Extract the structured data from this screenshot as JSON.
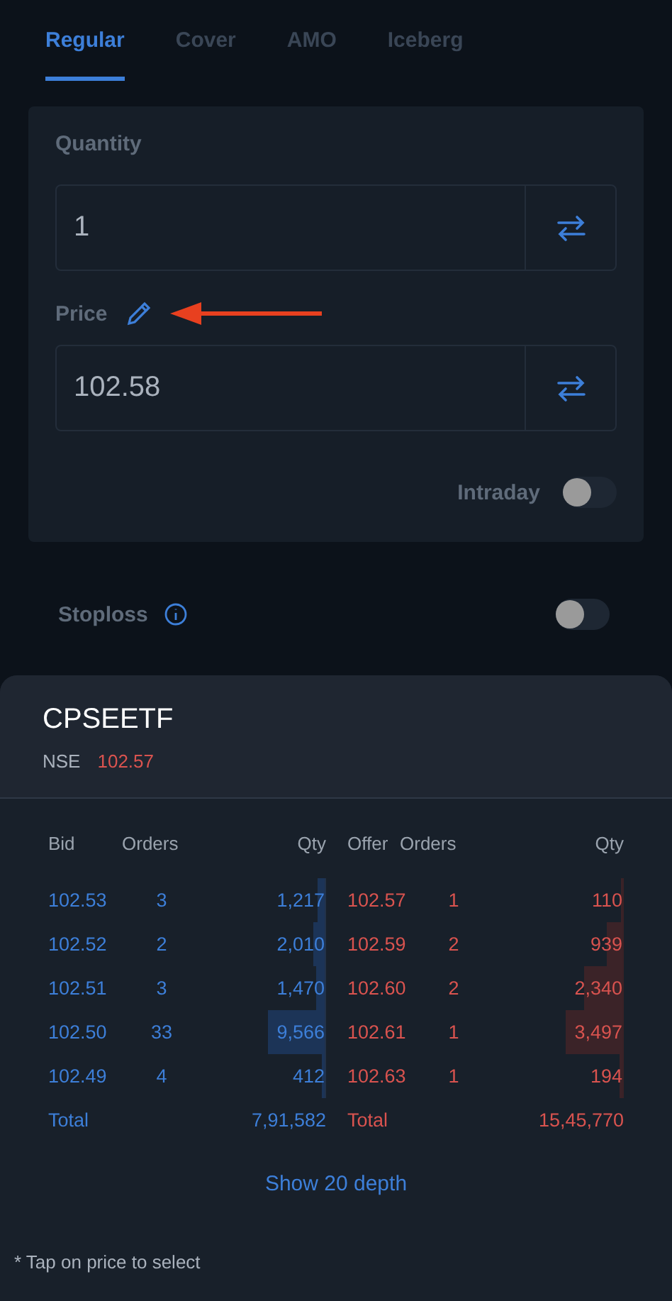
{
  "tabs": [
    {
      "label": "Regular",
      "selected": true
    },
    {
      "label": "Cover",
      "selected": false
    },
    {
      "label": "AMO",
      "selected": false
    },
    {
      "label": "Iceberg",
      "selected": false
    }
  ],
  "quantity": {
    "label": "Quantity",
    "value": "1"
  },
  "price": {
    "label": "Price",
    "value": "102.58"
  },
  "intraday": {
    "label": "Intraday",
    "on": false
  },
  "stoploss": {
    "label": "Stoploss",
    "on": false
  },
  "instrument": {
    "symbol": "CPSEETF",
    "exchange": "NSE",
    "ltp": "102.57"
  },
  "depth": {
    "columns": [
      "Bid",
      "Orders",
      "Qty",
      "Offer",
      "Orders",
      "Qty"
    ],
    "bids": [
      {
        "price": "102.53",
        "orders": "3",
        "qty": "1,217"
      },
      {
        "price": "102.52",
        "orders": "2",
        "qty": "2,010"
      },
      {
        "price": "102.51",
        "orders": "3",
        "qty": "1,470"
      },
      {
        "price": "102.50",
        "orders": "33",
        "qty": "9,566"
      },
      {
        "price": "102.49",
        "orders": "4",
        "qty": "412"
      }
    ],
    "offers": [
      {
        "price": "102.57",
        "orders": "1",
        "qty": "110"
      },
      {
        "price": "102.59",
        "orders": "2",
        "qty": "939"
      },
      {
        "price": "102.60",
        "orders": "2",
        "qty": "2,340"
      },
      {
        "price": "102.61",
        "orders": "1",
        "qty": "3,497"
      },
      {
        "price": "102.63",
        "orders": "1",
        "qty": "194"
      }
    ],
    "bid_total": {
      "label": "Total",
      "value": "7,91,582"
    },
    "offer_total": {
      "label": "Total",
      "value": "15,45,770"
    },
    "more": "Show 20 depth"
  },
  "footnote": "* Tap on price to select"
}
